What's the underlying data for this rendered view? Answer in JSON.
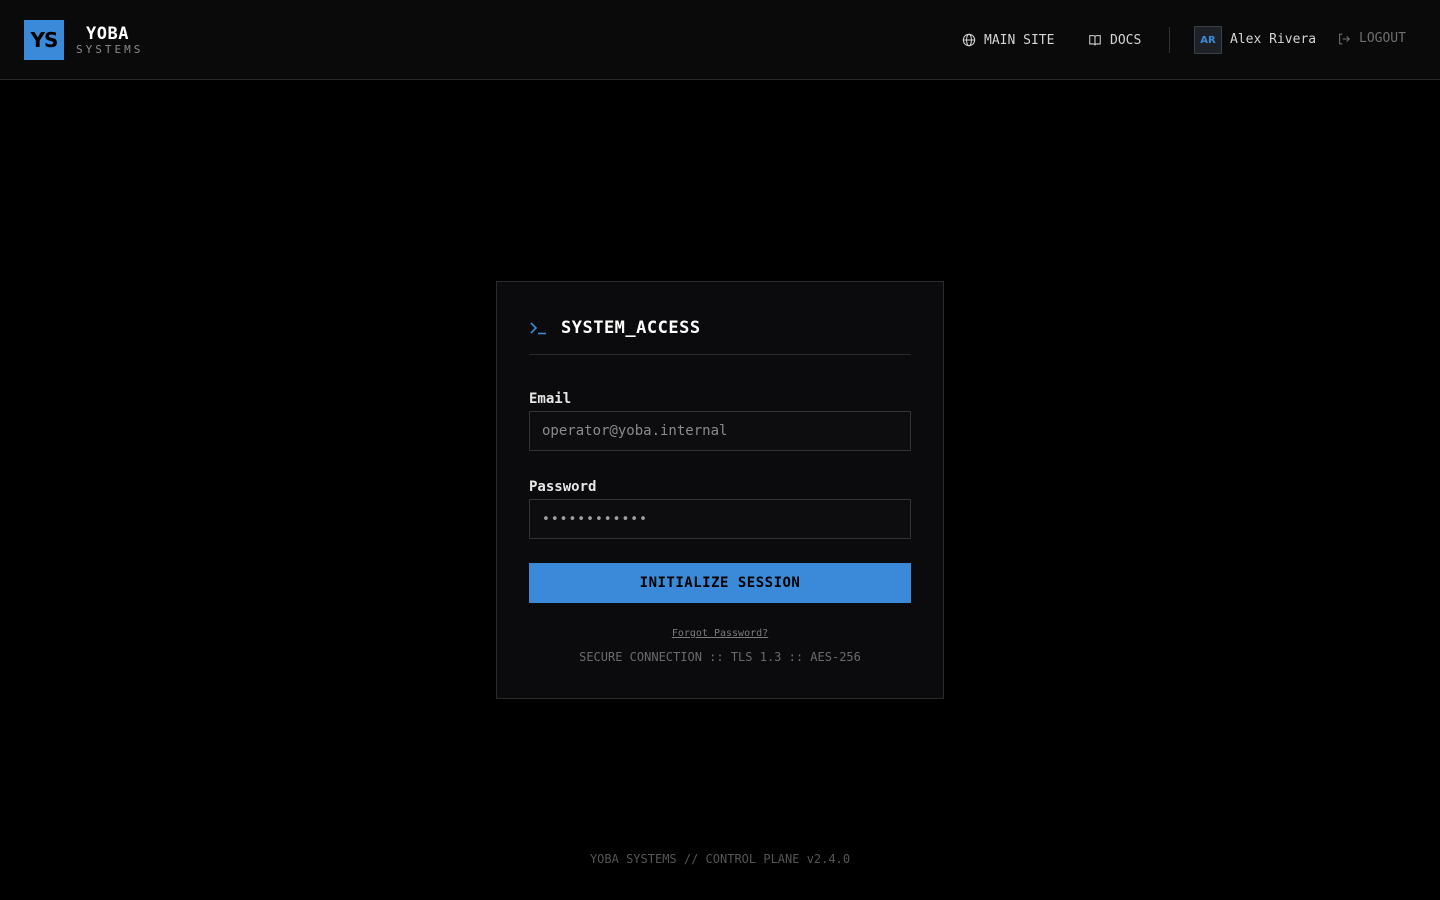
{
  "brand": {
    "logo_initials": "YS",
    "name": "YOBA",
    "subtitle": "SYSTEMS",
    "accent_color": "#3b8ad9"
  },
  "nav": {
    "items": [
      {
        "label": "MAIN SITE",
        "icon": "globe-icon"
      },
      {
        "label": "DOCS",
        "icon": "book-icon"
      }
    ],
    "user": {
      "initials": "AR",
      "name": "Alex Rivera"
    },
    "logout_label": "LOGOUT",
    "logout_icon": "logout-icon"
  },
  "login": {
    "title": "SYSTEM_ACCESS",
    "title_icon": "terminal-icon",
    "email": {
      "label": "Email",
      "placeholder": "operator@yoba.internal",
      "value": ""
    },
    "password": {
      "label": "Password",
      "value": "••••••••••••"
    },
    "submit_label": "INITIALIZE SESSION",
    "forgot_label": "Forgot Password?",
    "security_note": "SECURE CONNECTION :: TLS 1.3 :: AES-256"
  },
  "footer": {
    "text": "YOBA SYSTEMS // CONTROL PLANE v2.4.0"
  }
}
